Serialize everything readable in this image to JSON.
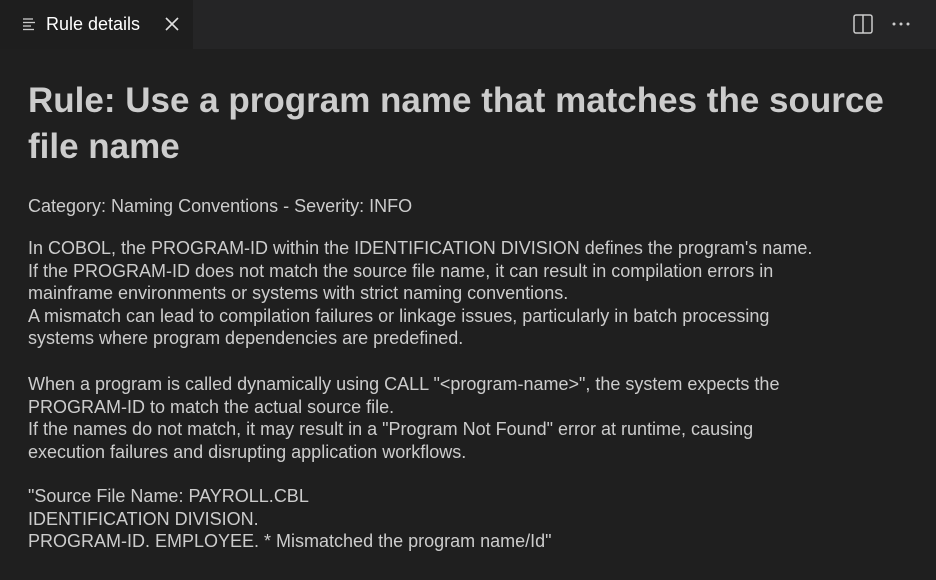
{
  "tab": {
    "label": "Rule details",
    "icon": "preview-lines-icon",
    "close_icon": "close-icon"
  },
  "actions": {
    "split_icon": "split-editor-icon",
    "more_icon": "more-actions-icon"
  },
  "rule": {
    "title": "Rule: Use a program name that matches the source file name",
    "meta": "Category: Naming Conventions - Severity: INFO",
    "paragraphs": [
      [
        "In COBOL, the PROGRAM-ID within the IDENTIFICATION DIVISION defines the program's name.",
        "If the PROGRAM-ID does not match the source file name, it can result in compilation errors in",
        "mainframe environments or systems with strict naming conventions.",
        "A mismatch can lead to compilation failures or linkage issues, particularly in batch processing",
        "systems where program dependencies are predefined."
      ],
      [
        "When a program is called dynamically using CALL \"<program-name>\", the system expects the",
        "PROGRAM-ID to match the actual source file.",
        "If the names do not match, it may result in a \"Program Not Found\" error at runtime, causing",
        "execution failures and disrupting application workflows."
      ],
      [
        "\"Source File Name: PAYROLL.CBL",
        "IDENTIFICATION DIVISION.",
        "PROGRAM-ID. EMPLOYEE. * Mismatched the program name/Id\""
      ]
    ]
  },
  "colors": {
    "background": "#1f1f1f",
    "tabbar": "#252526",
    "text": "#cccccc",
    "tab_text": "#ffffff"
  }
}
